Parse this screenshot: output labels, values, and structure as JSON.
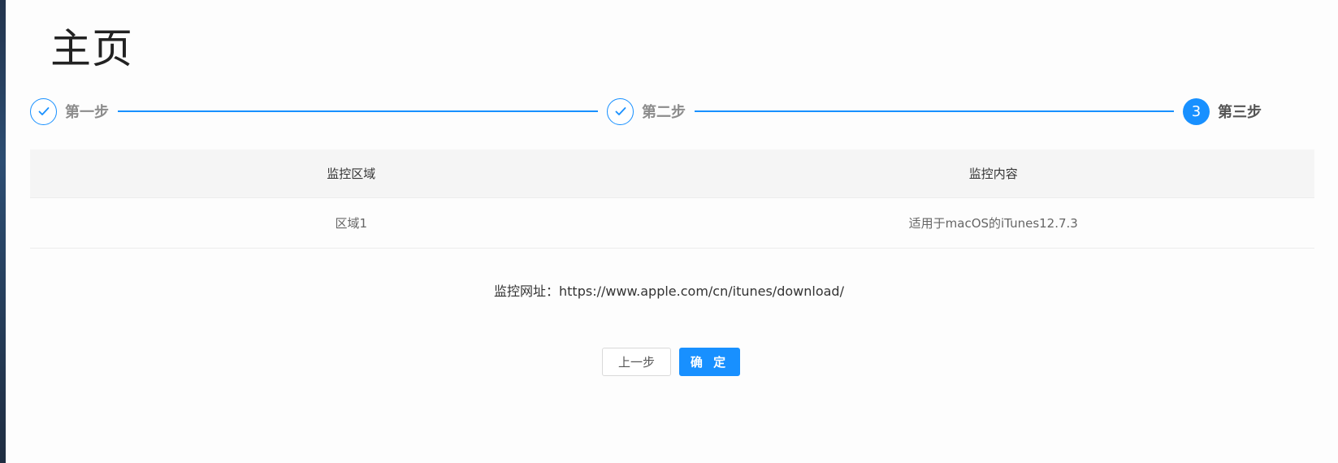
{
  "page": {
    "title": "主页"
  },
  "steps": [
    {
      "label": "第一步",
      "status": "done",
      "icon": "check-icon"
    },
    {
      "label": "第二步",
      "status": "done",
      "icon": "check-icon"
    },
    {
      "label": "第三步",
      "status": "current",
      "number": "3"
    }
  ],
  "table": {
    "headers": [
      "监控区域",
      "监控内容"
    ],
    "rows": [
      [
        "区域1",
        "适用于macOS的iTunes12.7.3"
      ]
    ]
  },
  "monitor": {
    "url_text": "监控网址：https://www.apple.com/cn/itunes/download/"
  },
  "actions": {
    "prev_label": "上一步",
    "confirm_label": "确 定"
  },
  "colors": {
    "accent": "#1890ff",
    "header_bg": "#f5f5f5"
  }
}
